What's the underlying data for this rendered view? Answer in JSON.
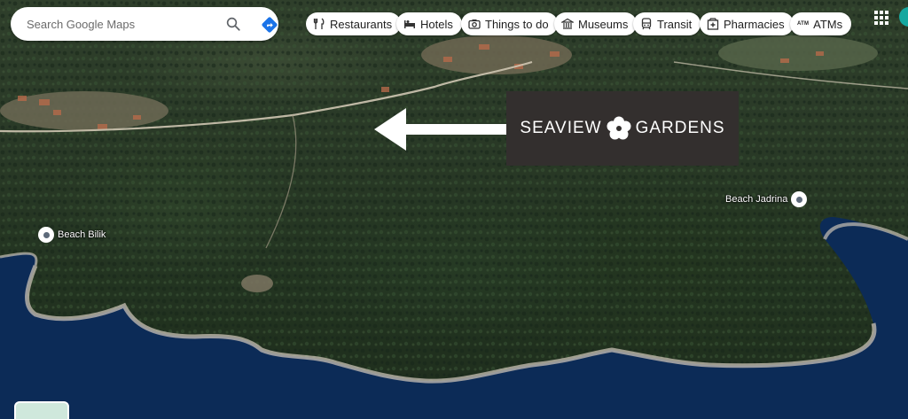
{
  "search": {
    "placeholder": "Search Google Maps"
  },
  "categories": [
    {
      "label": "Restaurants",
      "icon": "restaurant-icon"
    },
    {
      "label": "Hotels",
      "icon": "hotel-icon"
    },
    {
      "label": "Things to do",
      "icon": "camera-icon"
    },
    {
      "label": "Museums",
      "icon": "museum-icon"
    },
    {
      "label": "Transit",
      "icon": "transit-icon"
    },
    {
      "label": "Pharmacies",
      "icon": "pharmacy-icon"
    },
    {
      "label": "ATMs",
      "icon": "atm-icon",
      "tag": "ATM"
    }
  ],
  "places": {
    "beach_bilik": "Beach Bilik",
    "beach_jadrina": "Beach Jadrina"
  },
  "logo": {
    "left": "SEAVIEW",
    "right": "GARDENS"
  },
  "colors": {
    "directions": "#1a73e8",
    "logo_bg": "#332f2e",
    "water": "#0b2a55"
  }
}
